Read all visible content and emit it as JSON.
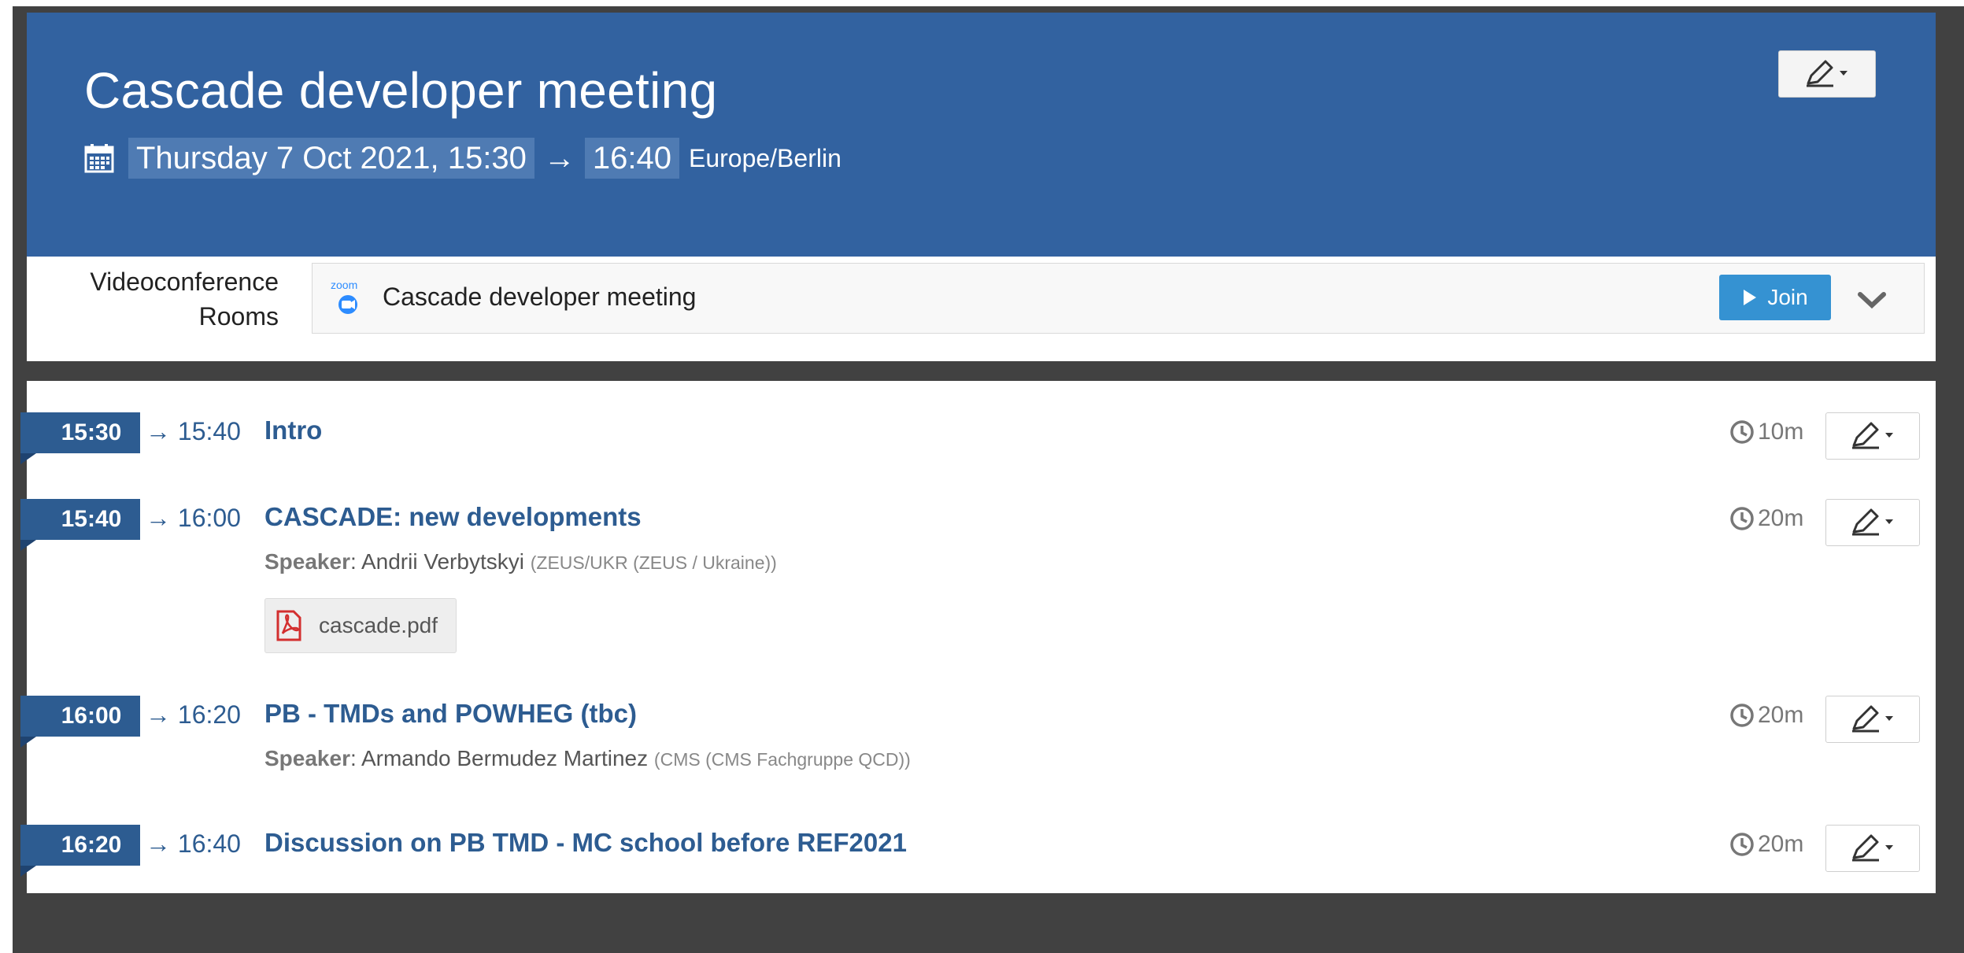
{
  "header": {
    "title": "Cascade developer meeting",
    "date_start": "Thursday 7 Oct 2021, 15:30",
    "arrow": "→",
    "date_end": "16:40",
    "timezone": "Europe/Berlin",
    "bg_color": "#3262a0"
  },
  "videoconference": {
    "label_line1": "Videoconference",
    "label_line2": "Rooms",
    "zoom_logo_text": "zoom",
    "room_name": "Cascade developer meeting",
    "join_label": "Join",
    "join_color": "#3592d2"
  },
  "timetable": {
    "accent_color": "#2d5c91",
    "contributions": [
      {
        "start": "15:30",
        "end": "→ 15:40",
        "title": "Intro",
        "duration": "10m"
      },
      {
        "start": "15:40",
        "end": "→ 16:00",
        "title": "CASCADE: new developments",
        "speaker_label": "Speaker",
        "speaker_name": ": Andrii Verbytskyi",
        "speaker_affiliation": "(ZEUS/UKR (ZEUS / Ukraine))",
        "attachment": "cascade.pdf",
        "duration": "20m"
      },
      {
        "start": "16:00",
        "end": "→ 16:20",
        "title": "PB - TMDs and POWHEG (tbc)",
        "speaker_label": "Speaker",
        "speaker_name": ": Armando Bermudez Martinez",
        "speaker_affiliation": "(CMS (CMS Fachgruppe QCD))",
        "duration": "20m"
      },
      {
        "start": "16:20",
        "end": "→ 16:40",
        "title": "Discussion on PB TMD - MC school before REF2021",
        "duration": "20m"
      }
    ]
  },
  "icons": {
    "calendar": "calendar-icon",
    "edit": "pencil-edit-icon",
    "clock": "clock-icon",
    "pdf": "pdf-file-icon",
    "play": "play-icon",
    "chevron": "chevron-down-icon"
  }
}
